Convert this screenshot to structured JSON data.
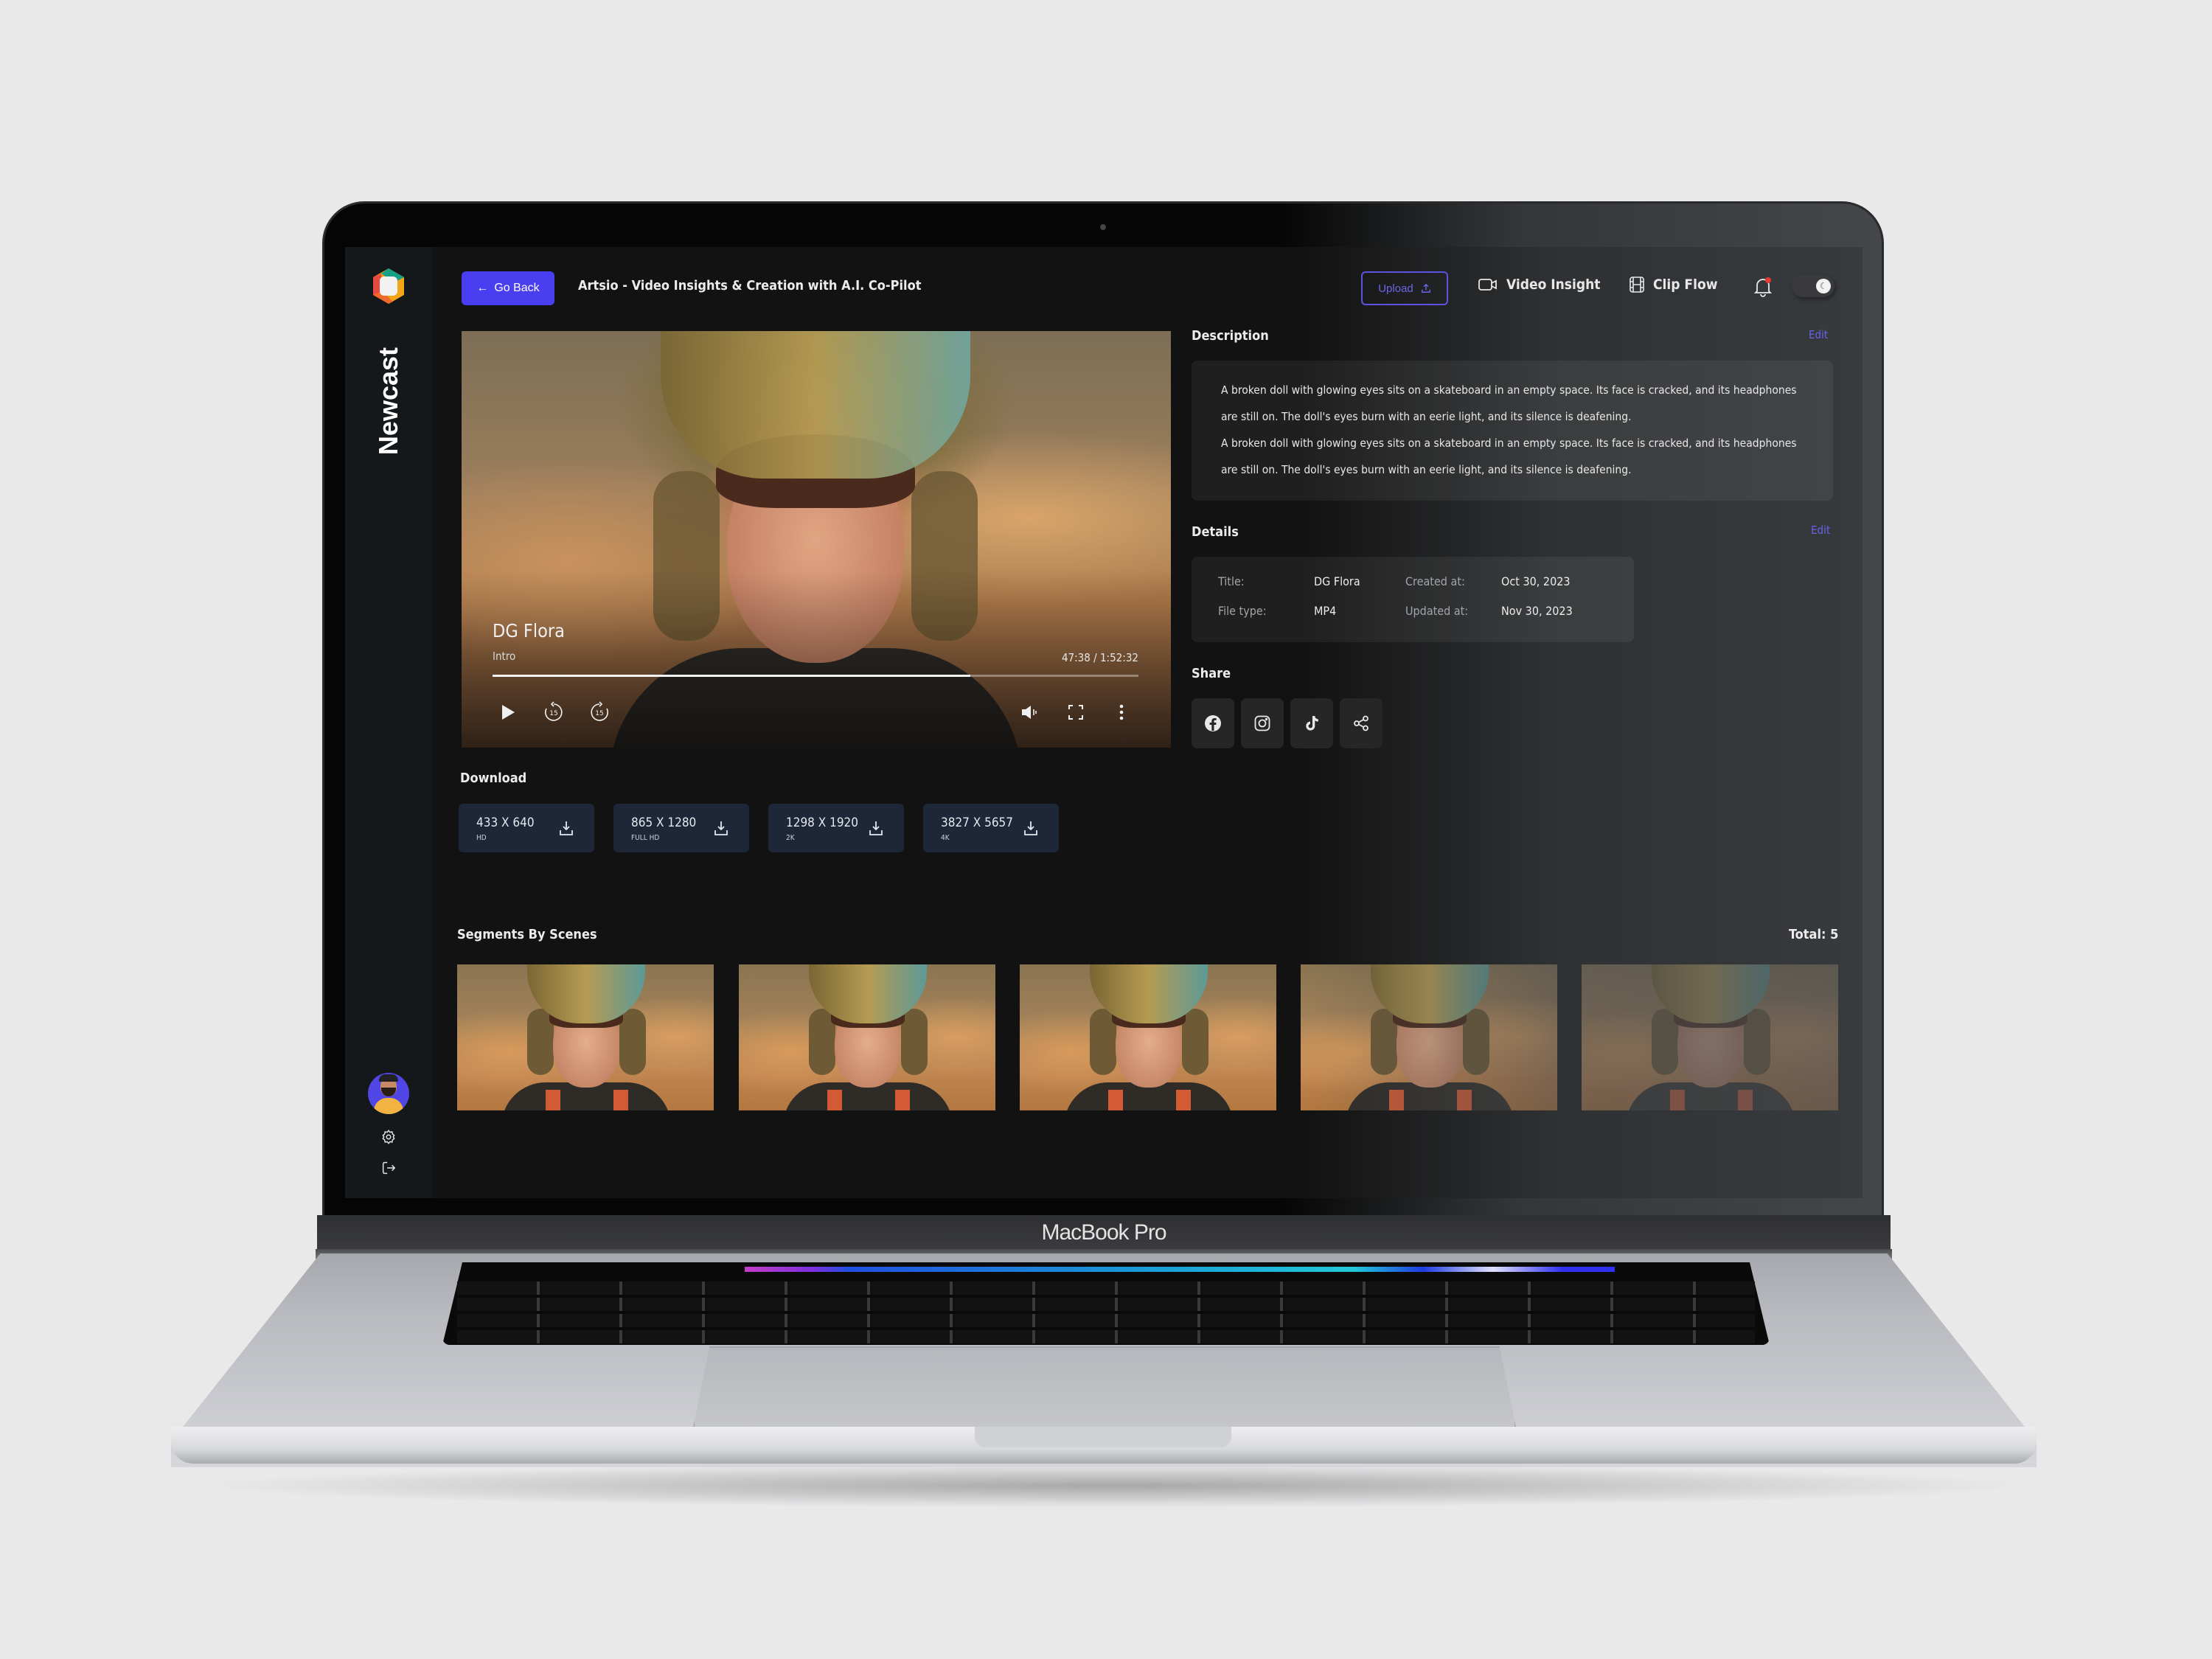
{
  "device": {
    "label": "MacBook Pro"
  },
  "sidebar": {
    "brand": "Newcast",
    "icons": [
      "logo-icon",
      "avatar",
      "settings-icon",
      "logout-icon"
    ]
  },
  "topbar": {
    "go_back_label": "Go Back",
    "title": "Artsio - Video Insights & Creation with A.I. Co-Pilot",
    "upload_label": "Upload",
    "nav": [
      {
        "label": "Video Insight",
        "icon": "video-camera-icon"
      },
      {
        "label": "Clip Flow",
        "icon": "film-icon"
      }
    ],
    "notification_badge": true,
    "theme_toggle": {
      "mode": "dark",
      "icon": "moon-icon"
    }
  },
  "player": {
    "title": "DG Flora",
    "subtitle": "Intro",
    "time": "47:38 / 1:52:32",
    "progress_percent": 74,
    "controls": [
      "play-icon",
      "rewind-15-icon",
      "forward-15-icon",
      "volume-icon",
      "fullscreen-icon",
      "more-options-icon"
    ],
    "skip_label": "15"
  },
  "download": {
    "title": "Download",
    "options": [
      {
        "resolution": "433 X 640",
        "quality": "HD"
      },
      {
        "resolution": "865 X 1280",
        "quality": "FULL HD"
      },
      {
        "resolution": "1298 X 1920",
        "quality": "2K"
      },
      {
        "resolution": "3827 X 5657",
        "quality": "4K"
      }
    ]
  },
  "description": {
    "title": "Description",
    "edit_label": "Edit",
    "paragraphs": [
      "A broken doll with glowing eyes sits on a skateboard in an empty space. Its face is cracked, and its headphones are still on. The doll's eyes burn with an eerie light, and its silence is deafening.",
      "A broken doll with glowing eyes sits on a skateboard in an empty space. Its face is cracked, and its headphones are still on. The doll's eyes burn with an eerie light, and its silence is deafening."
    ]
  },
  "details": {
    "title": "Details",
    "edit_label": "Edit",
    "fields": {
      "title_label": "Title:",
      "title_value": "DG Flora",
      "filetype_label": "File type:",
      "filetype_value": "MP4",
      "created_label": "Created at:",
      "created_value": "Oct 30, 2023",
      "updated_label": "Updated at:",
      "updated_value": "Nov 30, 2023"
    }
  },
  "share": {
    "title": "Share",
    "targets": [
      "facebook-icon",
      "instagram-icon",
      "tiktok-icon",
      "share-icon"
    ]
  },
  "segments": {
    "title": "Segments By Scenes",
    "total_label": "Total: 5",
    "count": 5
  },
  "colors": {
    "accent": "#4a3ff0",
    "accent_text": "#6a63e6",
    "download_card": "#1d2738",
    "notification": "#e53935"
  }
}
